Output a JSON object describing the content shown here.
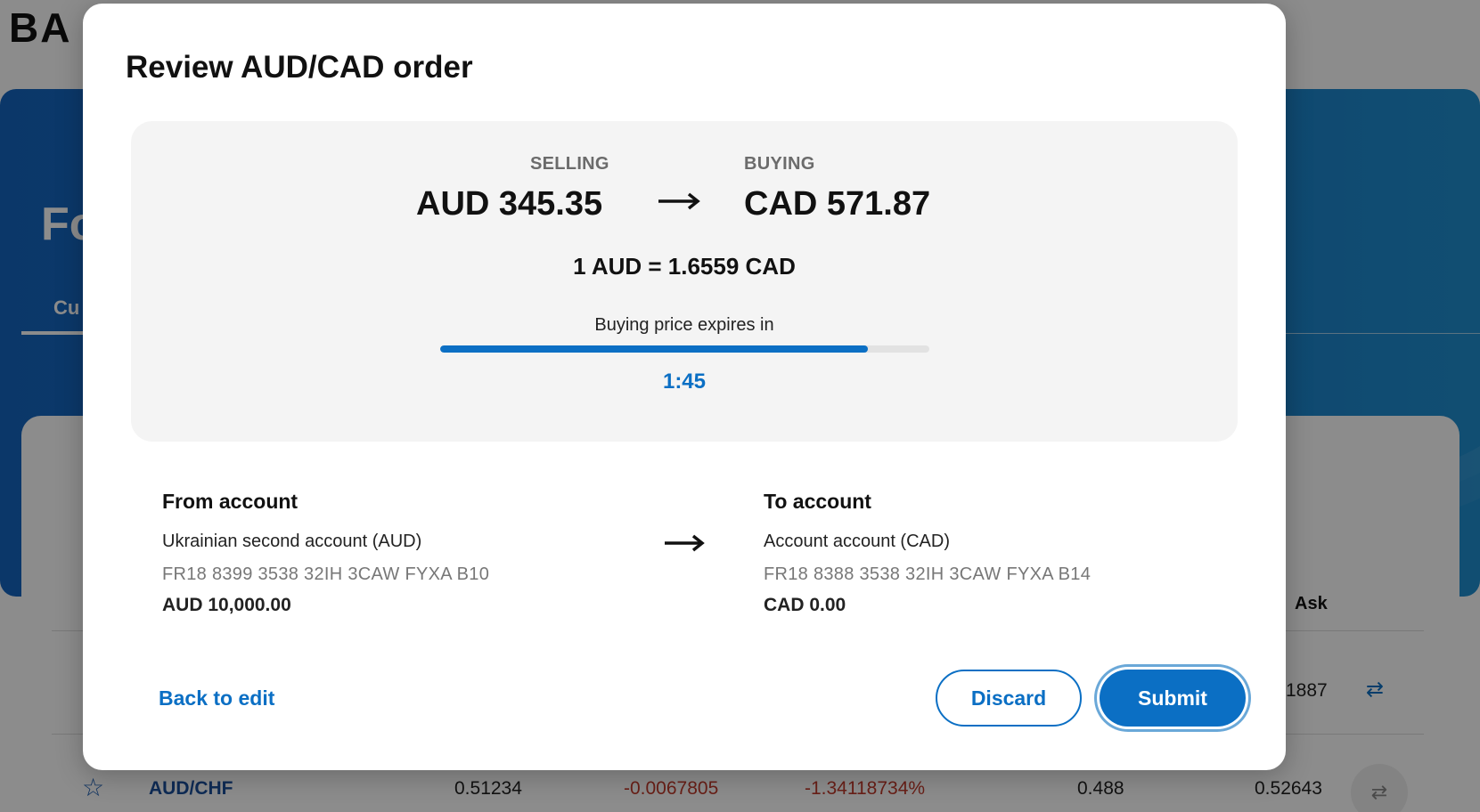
{
  "background": {
    "logo": "BA",
    "title": "Fo",
    "tab": "Cu",
    "ask_header": "Ask",
    "ask_value": "1887",
    "row2": {
      "pair": "AUD/CHF",
      "value": "0.51234",
      "change": "-0.0067805",
      "change_pct": "-1.34118734%",
      "bid": "0.488",
      "ask": "0.52643"
    }
  },
  "modal": {
    "title": "Review AUD/CAD order",
    "summary": {
      "selling_label": "SELLING",
      "selling_amount": "AUD 345.35",
      "buying_label": "BUYING",
      "buying_amount": "CAD 571.87",
      "rate": "1 AUD = 1.6559 CAD",
      "expires_label": "Buying price expires in",
      "progress_fraction": 0.875,
      "timer": "1:45"
    },
    "from_account": {
      "heading": "From account",
      "name": "Ukrainian second account (AUD)",
      "iban": "FR18 8399 3538 32IH 3CAW FYXA B10",
      "balance": "AUD 10,000.00"
    },
    "to_account": {
      "heading": "To account",
      "name": "Account account (CAD)",
      "iban": "FR18 8388 3538 32IH 3CAW FYXA B14",
      "balance": "CAD 0.00"
    },
    "actions": {
      "back_label": "Back to edit",
      "discard_label": "Discard",
      "submit_label": "Submit"
    }
  },
  "colors": {
    "accent": "#0b6fc4",
    "negative": "#c0392b",
    "summary_bg": "#f4f4f4"
  }
}
